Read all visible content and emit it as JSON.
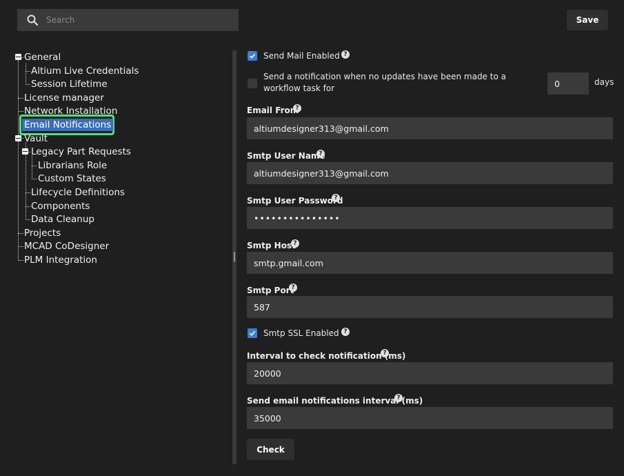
{
  "search": {
    "placeholder": "Search"
  },
  "toolbar": {
    "save_label": "Save"
  },
  "tree": {
    "general": "General",
    "altium_live_credentials": "Altium Live Credentials",
    "session_lifetime": "Session Lifetime",
    "license_manager": "License manager",
    "network_installation": "Network Installation",
    "email_notifications": "Email Notifications",
    "vault": "Vault",
    "legacy_part_requests": "Legacy Part Requests",
    "librarians_role": "Librarians Role",
    "custom_states": "Custom States",
    "lifecycle_definitions": "Lifecycle Definitions",
    "components": "Components",
    "data_cleanup": "Data Cleanup",
    "projects": "Projects",
    "mcad_codesigner": "MCAD CoDesigner",
    "plm_integration": "PLM Integration"
  },
  "form": {
    "send_mail_enabled": {
      "label": "Send Mail Enabled",
      "checked": true
    },
    "no_update_notification": {
      "label": "Send a notification when no updates have been made to a workflow task for",
      "checked": false,
      "value": "0",
      "unit": "days"
    },
    "email_from": {
      "label": "Email From",
      "value": "altiumdesigner313@gmail.com"
    },
    "smtp_user_name": {
      "label": "Smtp User Name",
      "value": "altiumdesigner313@gmail.com"
    },
    "smtp_user_password": {
      "label": "Smtp User Password",
      "value": "•••••••••••••••"
    },
    "smtp_host": {
      "label": "Smtp Host",
      "value": "smtp.gmail.com"
    },
    "smtp_port": {
      "label": "Smtp Port",
      "value": "587"
    },
    "smtp_ssl_enabled": {
      "label": "Smtp SSL Enabled",
      "checked": true
    },
    "interval_check": {
      "label": "Interval to check notification (ms)",
      "value": "20000"
    },
    "send_interval": {
      "label": "Send email notifications interval (ms)",
      "value": "35000"
    },
    "check_label": "Check",
    "help_glyph": "?"
  },
  "colors": {
    "background": "#1f1f1f",
    "field": "#3a3a3a",
    "accent": "#3c7fd0",
    "selection": "#3c6eb0",
    "highlight_ring": "#53e07a"
  }
}
